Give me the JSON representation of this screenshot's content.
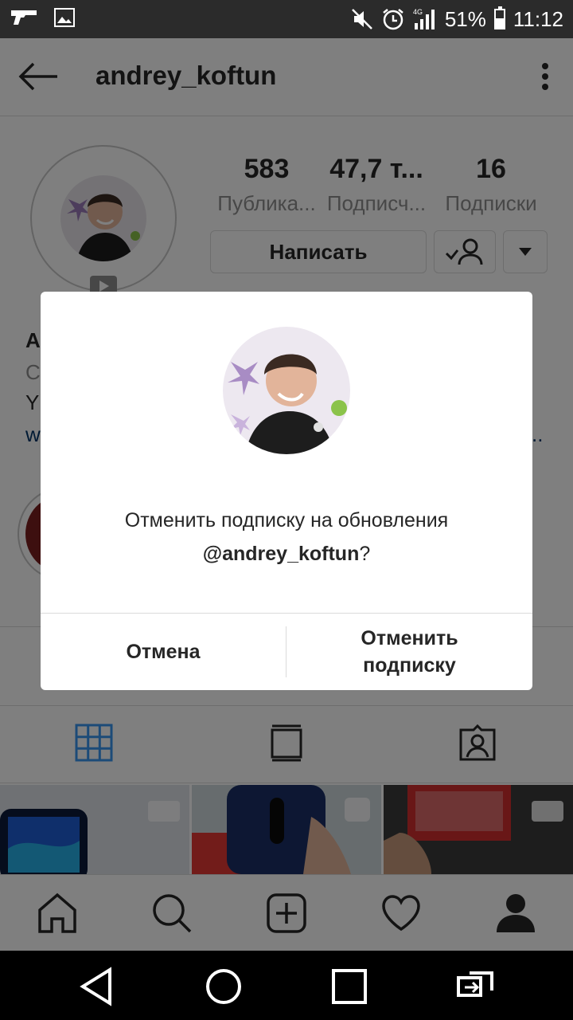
{
  "status_bar": {
    "battery": "51%",
    "time": "11:12",
    "network": "4G"
  },
  "header": {
    "username": "andrey_koftun"
  },
  "profile": {
    "stats": [
      {
        "value": "583",
        "label": "Публика..."
      },
      {
        "value": "47,7 т...",
        "label": "Подписч..."
      },
      {
        "value": "16",
        "label": "Подписки"
      }
    ],
    "message_button": "Написать",
    "bio_peek": [
      "А",
      "С",
      "Y(",
      "w"
    ],
    "link_ellipsis": ".."
  },
  "dialog": {
    "message_prefix": "Отменить подписку на обновления",
    "handle": "@andrey_koftun",
    "message_suffix": "?",
    "cancel_label": "Отмена",
    "unfollow_label_line1": "Отменить",
    "unfollow_label_line2": "подписку"
  },
  "tabs": [
    "grid-icon",
    "igtv-icon",
    "tagged-icon"
  ],
  "bottom_nav": [
    "home-icon",
    "search-icon",
    "add-post-icon",
    "activity-icon",
    "profile-icon"
  ],
  "colors": {
    "active_tab": "#3897f0",
    "overlay": "rgba(0,0,0,0.5)"
  }
}
